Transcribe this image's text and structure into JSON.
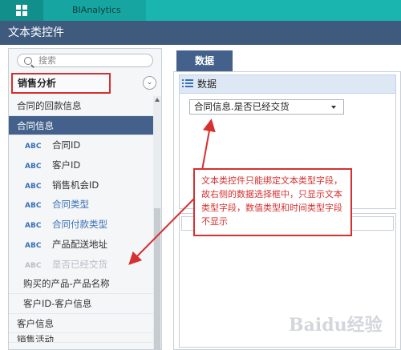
{
  "app": {
    "name": "BIAnalytics"
  },
  "page": {
    "title": "文本类控件"
  },
  "left_panel": {
    "search_placeholder": "搜索",
    "dataset": {
      "label": "销售分析",
      "toggle_icon": "chevron-down-icon"
    },
    "tree": [
      {
        "kind": "row",
        "label": "合同的回款信息"
      },
      {
        "kind": "row-selected",
        "label": "合同信息"
      },
      {
        "kind": "field",
        "type": "ABC",
        "label": "合同ID"
      },
      {
        "kind": "field",
        "type": "ABC",
        "label": "客户ID"
      },
      {
        "kind": "field",
        "type": "ABC",
        "label": "销售机会ID"
      },
      {
        "kind": "field-blue",
        "type": "ABC",
        "label": "合同类型"
      },
      {
        "kind": "field-blue",
        "type": "ABC",
        "label": "合同付款类型"
      },
      {
        "kind": "field",
        "type": "ABC",
        "label": "产品配送地址"
      },
      {
        "kind": "field-disabled",
        "type": "ABC",
        "label": "是否已经交货"
      },
      {
        "kind": "sub",
        "label": "购买的产品-产品名称"
      },
      {
        "kind": "sub",
        "label": "客户ID-客户信息"
      },
      {
        "kind": "row",
        "label": "客户信息"
      },
      {
        "kind": "row-cut",
        "label": "销售活动"
      }
    ]
  },
  "right_panel": {
    "tab_label": "数据",
    "section_label": "数据",
    "selected_field": "合同信息.是否已经交货"
  },
  "annotation": {
    "text": "文本类控件只能绑定文本类型字段，故右侧的数据选择框中，只显示文本类型字段，数值类型和时间类型字段不显示"
  },
  "watermark": {
    "text": "Baidu经验"
  },
  "colors": {
    "topbar": "#1bb5b0",
    "titlebar": "#3e5b7e",
    "selected_row": "#43618a",
    "field_type": "#3a6fb7",
    "annotation": "#d63030"
  }
}
